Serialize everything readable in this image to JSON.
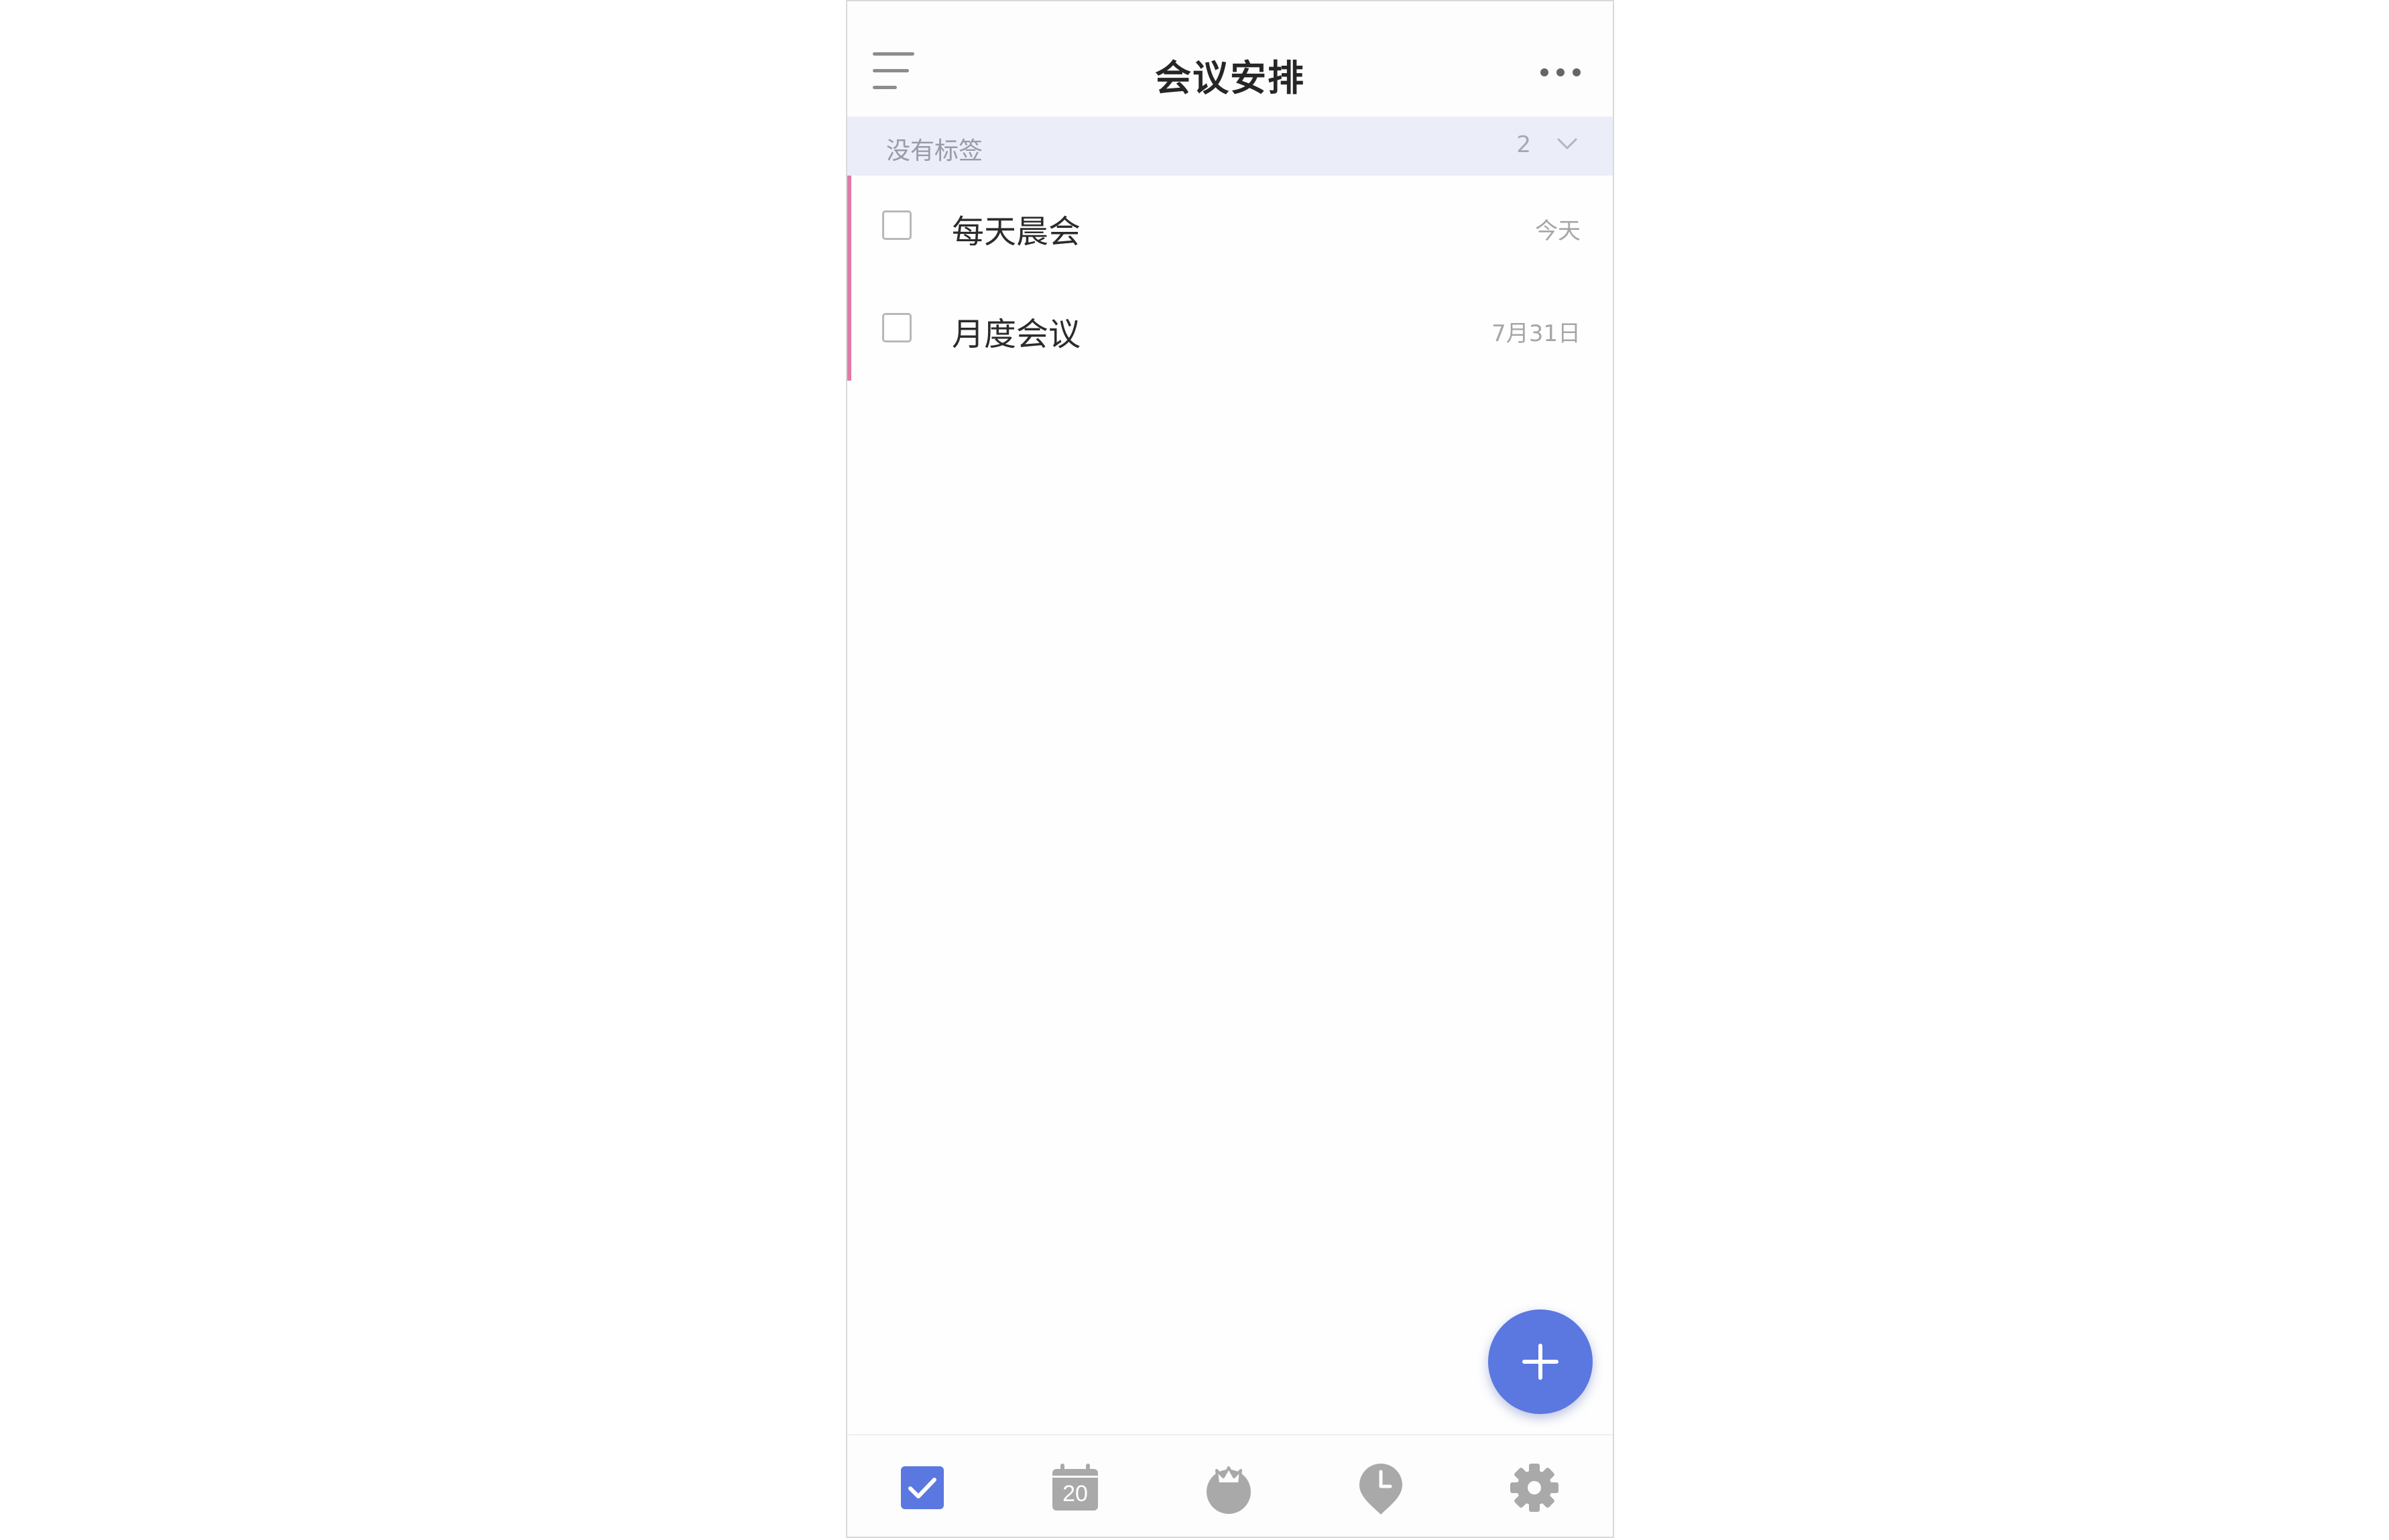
{
  "header": {
    "title": "会议安排"
  },
  "section": {
    "label": "没有标签",
    "count": "2"
  },
  "tasks": [
    {
      "title": "每天晨会",
      "date": "今天"
    },
    {
      "title": "月度会议",
      "date": "7月31日"
    }
  ],
  "bottom_nav": {
    "items": [
      {
        "icon": "checkbox-tasks-icon",
        "active": true
      },
      {
        "icon": "calendar-icon",
        "label": "20",
        "active": false
      },
      {
        "icon": "pomodoro-icon",
        "active": false
      },
      {
        "icon": "clock-icon",
        "active": false
      },
      {
        "icon": "gear-icon",
        "active": false
      }
    ]
  },
  "colors": {
    "accent": "#5b77e0",
    "priority_bar": "#e07aa7",
    "section_bg": "#ebedf9",
    "inactive_icon": "#a9a9a9"
  }
}
